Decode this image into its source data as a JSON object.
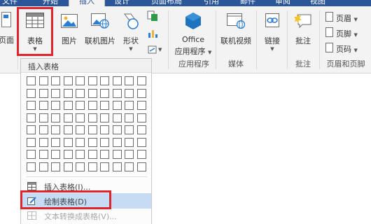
{
  "tabs": [
    {
      "label": "文件",
      "active": false
    },
    {
      "label": "开始",
      "active": false
    },
    {
      "label": "插入",
      "active": true
    },
    {
      "label": "设计",
      "active": false
    },
    {
      "label": "页面布局",
      "active": false
    },
    {
      "label": "引用",
      "active": false
    },
    {
      "label": "邮件",
      "active": false
    },
    {
      "label": "审阅",
      "active": false
    },
    {
      "label": "视图",
      "active": false
    }
  ],
  "ribbon": {
    "page_label": "页面",
    "table_label": "表格",
    "picture_label": "图片",
    "online_picture_label": "联机图片",
    "shapes_label": "形状",
    "office_line1": "Office",
    "office_line2": "应用程序",
    "online_video_label": "联机视频",
    "link_label": "链接",
    "comment_label": "批注",
    "header_label": "页眉",
    "footer_label": "页脚",
    "page_number_label": "页码",
    "groups": {
      "apps": "应用程序",
      "media": "媒体",
      "comments": "批注",
      "header_footer": "页眉和页脚"
    }
  },
  "menu": {
    "title": "插入表格",
    "grid": {
      "cols": 10,
      "rows": 8
    },
    "items": [
      {
        "label": "插入表格(I)...",
        "icon": "table-icon",
        "highlighted": false,
        "disabled": false
      },
      {
        "label": "绘制表格(D)",
        "icon": "draw-table-icon",
        "highlighted": true,
        "disabled": false
      },
      {
        "label": "文本转换成表格(V)...",
        "icon": "text-to-table-icon",
        "highlighted": false,
        "disabled": true
      }
    ]
  },
  "colors": {
    "brand": "#2b579a",
    "highlight_box": "#e0242b",
    "menu_hover": "#c5dcf4",
    "office_icon": "#1e73be"
  }
}
